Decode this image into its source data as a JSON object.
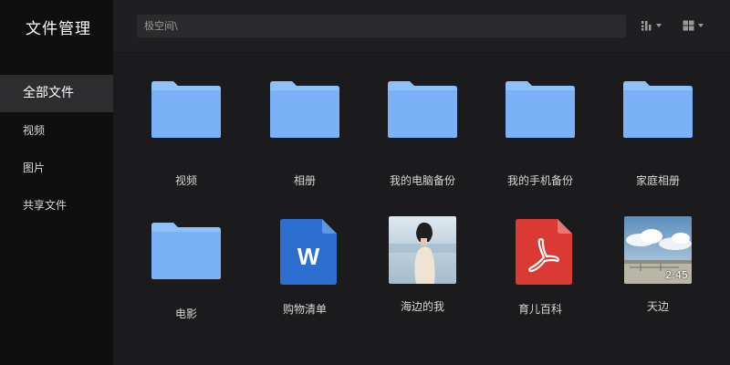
{
  "app": {
    "title": "文件管理"
  },
  "sidebar": {
    "items": [
      {
        "label": "全部文件",
        "active": true
      },
      {
        "label": "视频",
        "active": false
      },
      {
        "label": "图片",
        "active": false
      },
      {
        "label": "共享文件",
        "active": false
      }
    ]
  },
  "header": {
    "path": "极空间\\",
    "sort_icon": "sort-icon",
    "view_icon": "grid-view-icon"
  },
  "files": [
    {
      "name": "视频",
      "type": "folder"
    },
    {
      "name": "相册",
      "type": "folder"
    },
    {
      "name": "我的电脑备份",
      "type": "folder"
    },
    {
      "name": "我的手机备份",
      "type": "folder"
    },
    {
      "name": "家庭相册",
      "type": "folder"
    },
    {
      "name": "电影",
      "type": "folder"
    },
    {
      "name": "购物清单",
      "type": "word-document",
      "icon_letter": "W"
    },
    {
      "name": "海边的我",
      "type": "image"
    },
    {
      "name": "育儿百科",
      "type": "pdf"
    },
    {
      "name": "天边",
      "type": "video",
      "duration": "2:45"
    }
  ],
  "colors": {
    "folder": "#7ab1f7",
    "folder_tab": "#8ec0fa",
    "word": "#2d6fd0",
    "pdf": "#d93a33",
    "sidebar_bg": "#0f0f10",
    "content_bg": "#1b1b1d"
  }
}
